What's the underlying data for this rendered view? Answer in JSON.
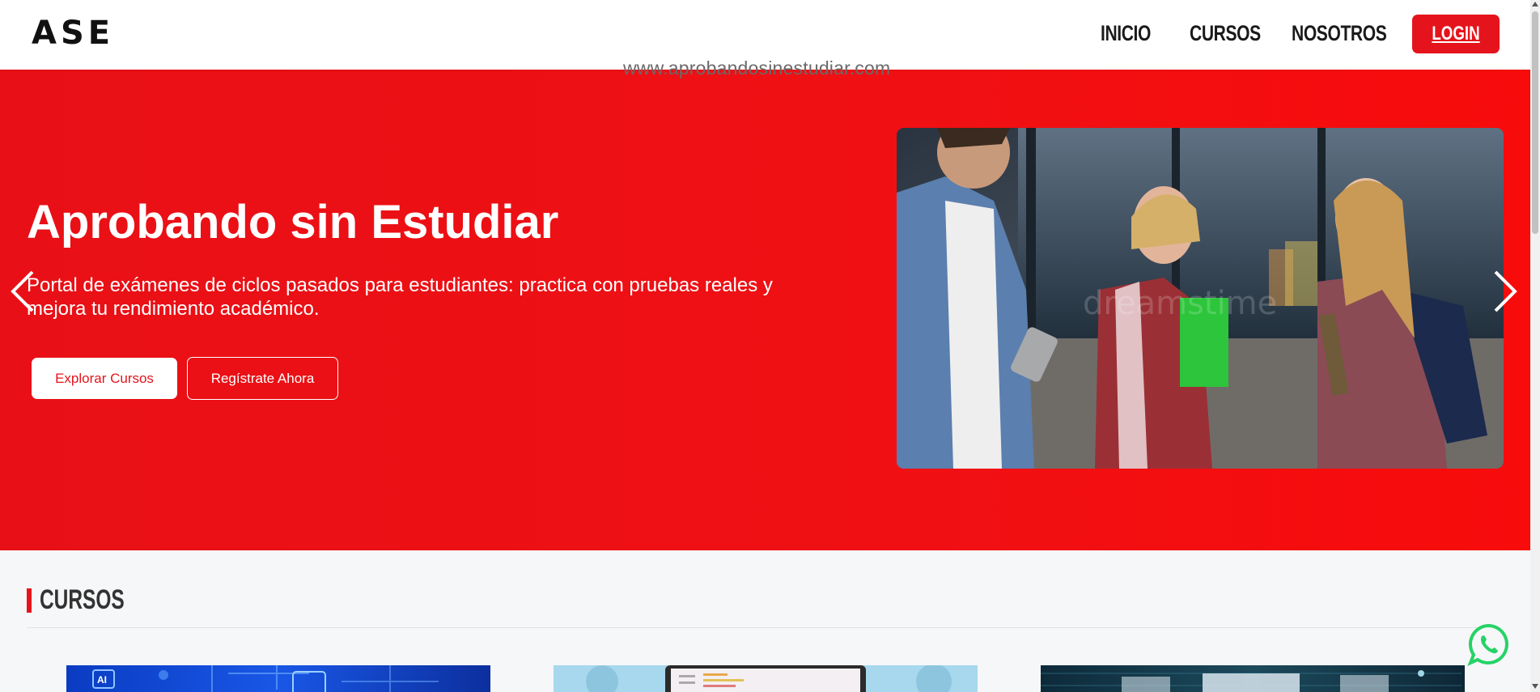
{
  "brand": {
    "logo": "ASE",
    "accent_color": "#e5141c"
  },
  "nav": {
    "items": [
      {
        "label": "INICIO"
      },
      {
        "label": "CURSOS"
      },
      {
        "label": "NOSOTROS"
      }
    ],
    "login_label": "LOGIN"
  },
  "watermark": {
    "url_text": "www.aprobandosinestudiar.com"
  },
  "hero": {
    "title": "Aprobando sin Estudiar",
    "subtitle": "Portal de exámenes de ciclos pasados para estudiantes: practica con pruebas reales y mejora tu rendimiento académico.",
    "explore_button": "Explorar Cursos",
    "register_button": "Regístrate Ahora",
    "image_watermark": "dreamstime",
    "prev_icon": "chevron-left-icon",
    "next_icon": "chevron-right-icon"
  },
  "courses": {
    "section_title": "CURSOS",
    "cards": [
      {
        "badge": "AI",
        "theme": "ai-circuit"
      },
      {
        "theme": "laptop-code"
      },
      {
        "theme": "tech-network"
      }
    ]
  },
  "floating": {
    "icon": "whatsapp-icon",
    "color": "#25d366"
  }
}
